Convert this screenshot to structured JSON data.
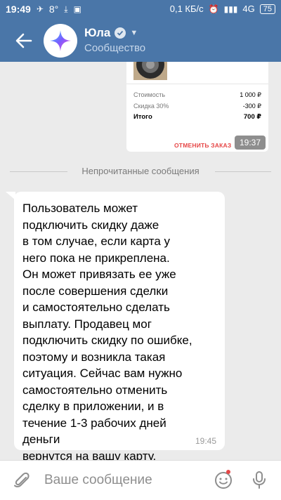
{
  "status_bar": {
    "time": "19:49",
    "temperature": "8°",
    "network_speed": "0,1 КБ/с",
    "network_type": "4G",
    "battery": "75"
  },
  "header": {
    "title": "Юла",
    "subtitle": "Сообщество"
  },
  "order_card": {
    "rows": [
      {
        "label": "Стоимость",
        "value": "1 000 ₽"
      },
      {
        "label": "Скидка 30%",
        "value": "-300 ₽"
      }
    ],
    "total_label": "Итого",
    "total_value": "700 ₽",
    "cancel_label": "ОТМЕНИТЬ ЗАКАЗ",
    "time": "19:37"
  },
  "unread_divider": "Непрочитанные сообщения",
  "message": {
    "text": "Пользователь может\nподключить скидку даже\nв том случае, если карта у\nнего пока не прикреплена.\nОн может привязать ее уже\nпосле совершения сделки\nи самостоятельно сделать\nвыплату. Продавец мог\nподключить скидку по ошибке,\nпоэтому и возникла такая\nситуация. Сейчас вам нужно\nсамостоятельно отменить\nсделку в приложении, и в\nтечение 1-3 рабочих дней деньги\nвернутся на вашу карту.",
    "time": "19:45"
  },
  "input": {
    "placeholder": "Ваше сообщение"
  },
  "colors": {
    "header": "#4a76a8",
    "background": "#ebebeb",
    "cancel": "#e64646"
  }
}
